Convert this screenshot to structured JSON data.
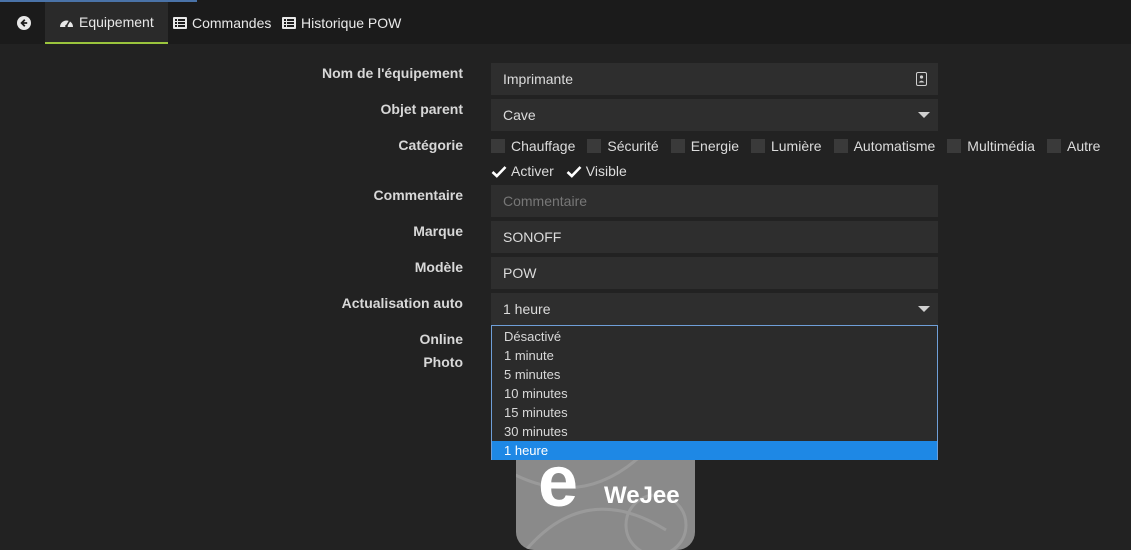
{
  "tabs": {
    "back_icon": "arrow-circle-left-icon",
    "equipement": "Equipement",
    "commandes": "Commandes",
    "historique": "Historique POW"
  },
  "form": {
    "nom_label": "Nom de l'équipement",
    "nom_value": "Imprimante",
    "parent_label": "Objet parent",
    "parent_value": "Cave",
    "categorie_label": "Catégorie",
    "categories": [
      "Chauffage",
      "Sécurité",
      "Energie",
      "Lumière",
      "Automatisme",
      "Multimédia",
      "Autre"
    ],
    "activer": "Activer",
    "visible": "Visible",
    "commentaire_label": "Commentaire",
    "commentaire_placeholder": "Commentaire",
    "marque_label": "Marque",
    "marque_value": "SONOFF",
    "modele_label": "Modèle",
    "modele_value": "POW",
    "actualisation_label": "Actualisation auto",
    "actualisation_value": "1 heure",
    "online_label": "Online",
    "photo_label": "Photo"
  },
  "dropdown": {
    "options": [
      "Désactivé",
      "1 minute",
      "5 minutes",
      "10 minutes",
      "15 minutes",
      "30 minutes",
      "1 heure"
    ],
    "selected": "1 heure"
  },
  "photo": {
    "letter": "e",
    "brand": "WeJee"
  },
  "colors": {
    "accent_tab": "#9bc53d",
    "selected_option": "#1e88e5",
    "dropdown_border": "#6f9fd8"
  }
}
